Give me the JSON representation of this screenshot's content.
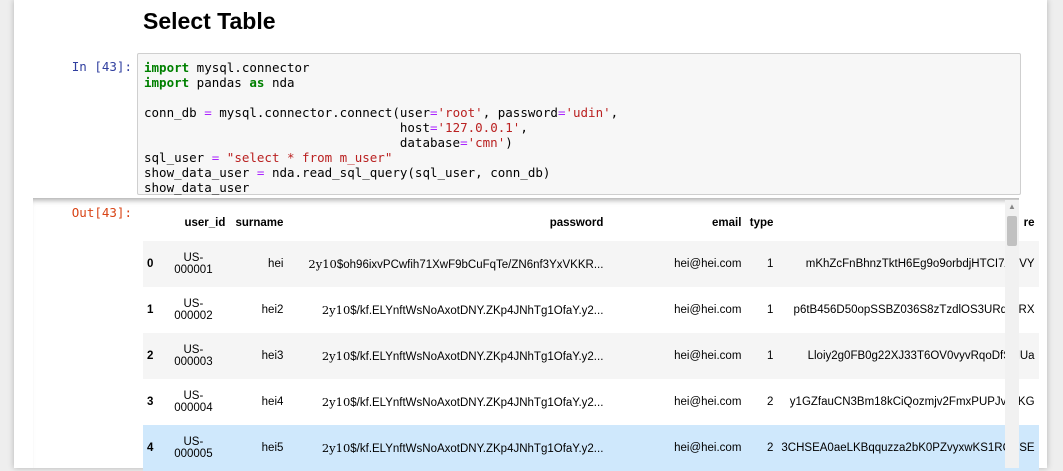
{
  "heading": "Select Table",
  "prompts": {
    "in": "In [43]:",
    "out": "Out[43]:"
  },
  "code_lines": [
    "import mysql.connector",
    "import pandas as nda",
    "",
    "conn_db = mysql.connector.connect(user='root', password='udin',",
    "                                  host='127.0.0.1',",
    "                                  database='cmn')",
    "sql_user = \"select * from m_user\"",
    "show_data_user = nda.read_sql_query(sql_user, conn_db)",
    "show_data_user"
  ],
  "table": {
    "columns": [
      "",
      "user_id",
      "surname",
      "password",
      "email",
      "type",
      "re"
    ],
    "rows": [
      {
        "index": "0",
        "user_id_a": "US-",
        "user_id_b": "000001",
        "surname": "hei",
        "pw_math": "2y10",
        "pw_rest": "$oh96ixvPCwfih71XwF9bCuFqTe/ZN6nf3YxVKKR...",
        "email": "hei@hei.com",
        "type": "1",
        "re": "mKhZcFnBhnzTktH6Eg9o9orbdjHTCI7AZVY"
      },
      {
        "index": "1",
        "user_id_a": "US-",
        "user_id_b": "000002",
        "surname": "hei2",
        "pw_math": "2y10",
        "pw_rest": "$/kf.ELYnftWsNoAxotDNY.ZKp4JNhTg1OfaY.y2...",
        "email": "hei@hei.com",
        "type": "1",
        "re": "p6tB456D50opSSBZ036S8zTzdlOS3URqckRX"
      },
      {
        "index": "2",
        "user_id_a": "US-",
        "user_id_b": "000003",
        "surname": "hei3",
        "pw_math": "2y10",
        "pw_rest": "$/kf.ELYnftWsNoAxotDNY.ZKp4JNhTg1OfaY.y2...",
        "email": "hei@hei.com",
        "type": "1",
        "re": "Lloiy2g0FB0g22XJ33T6OV0vyvRqoDfS6lUa"
      },
      {
        "index": "3",
        "user_id_a": "US-",
        "user_id_b": "000004",
        "surname": "hei4",
        "pw_math": "2y10",
        "pw_rest": "$/kf.ELYnftWsNoAxotDNY.ZKp4JNhTg1OfaY.y2...",
        "email": "hei@hei.com",
        "type": "2",
        "re": "y1GZfauCN3Bm18kCiQozmjv2FmxPUPJvlOKG"
      },
      {
        "index": "4",
        "user_id_a": "US-",
        "user_id_b": "000005",
        "surname": "hei5",
        "pw_math": "2y10",
        "pw_rest": "$/kf.ELYnftWsNoAxotDNY.ZKp4JNhTg1OfaY.y2...",
        "email": "hei@hei.com",
        "type": "2",
        "re": "3CHSEA0aeLKBqquzza2bK0PZvyxwKS1RQVSE"
      }
    ]
  },
  "scrollbar": {
    "up_icon": "▲"
  }
}
